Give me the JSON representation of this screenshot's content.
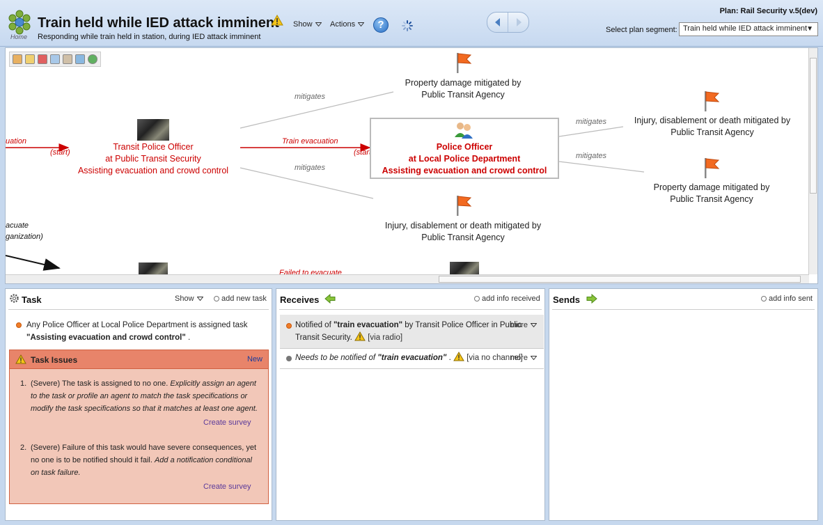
{
  "header": {
    "home_label": "Home",
    "title": "Train held while IED attack imminent",
    "subtitle": "Responding while train held in station, during IED attack imminent",
    "menus": {
      "show": "Show",
      "actions": "Actions"
    },
    "help": "?",
    "plan_name": "Plan: Rail Security v.5(dev)",
    "segment_label": "Select plan segment:",
    "segment_value": "Train held while IED attack imminent"
  },
  "flowmap": {
    "nodes": {
      "left_role": {
        "line1": "Transit Police Officer",
        "line2": "at Public Transit Security",
        "line3": "Assisting evacuation and crowd control"
      },
      "selected_role": {
        "line1": "Police Officer",
        "line2": "at Local Police Department",
        "line3": "Assisting evacuation and crowd control"
      },
      "risk_top": {
        "line1": "Property damage mitigated by",
        "line2": "Public Transit Agency"
      },
      "risk_bottom": {
        "line1": "Injury, disablement or death mitigated by",
        "line2": "Public Transit Agency"
      },
      "risk_right_top": {
        "line1": "Injury, disablement or death mitigated by",
        "line2": "Public Transit Agency"
      },
      "risk_right_bottom": {
        "line1": "Property damage mitigated by",
        "line2": "Public Transit Agency"
      }
    },
    "edges": {
      "left_in": "uation",
      "start_left": "(start)",
      "train_evac": "Train evacuation",
      "start_mid": "(start)",
      "mitigates_1": "mitigates",
      "mitigates_2": "mitigates",
      "mitigates_3": "mitigates",
      "mitigates_4": "mitigates",
      "partial_1": "acuate",
      "partial_2": "ganization)",
      "failed": "Failed to evacuate"
    }
  },
  "task_panel": {
    "title": "Task",
    "show": "Show",
    "add": "add new task",
    "assignment_text": "Any Police Officer at Local Police Department is assigned task",
    "assignment_task": "\"Assisting evacuation and crowd control\"",
    "assignment_end": ".",
    "issues": {
      "title": "Task Issues",
      "new": "New",
      "items": [
        {
          "num": "1.",
          "plain": "(Severe) The task is assigned to no one. ",
          "italic": "Explicitly assign an agent to the task or profile an agent to match the task specifications or modify the task specifications so that it matches at least one agent.",
          "link": "Create survey"
        },
        {
          "num": "2.",
          "plain": "(Severe) Failure of this task would have severe consequences, yet no one is to be notified should it fail. ",
          "italic": "Add a notification conditional on task failure.",
          "link": "Create survey"
        }
      ]
    }
  },
  "receives_panel": {
    "title": "Receives",
    "add": "add info received",
    "items": [
      {
        "pre": "Notified of ",
        "info": "\"train evacuation\"",
        "post": " by Transit Police Officer in Public Transit Security. ",
        "channel": "[via radio]",
        "more": "more"
      },
      {
        "pre": "Needs to be notified of ",
        "info": "\"train evacuation\"",
        "post": " . ",
        "channel": "[via no channel]",
        "more": "more"
      }
    ]
  },
  "sends_panel": {
    "title": "Sends",
    "add": "add info sent"
  },
  "colors": {
    "accent_red": "#cc0000",
    "flag_orange": "#f26a21",
    "header_blue": "#c7d9f0"
  }
}
